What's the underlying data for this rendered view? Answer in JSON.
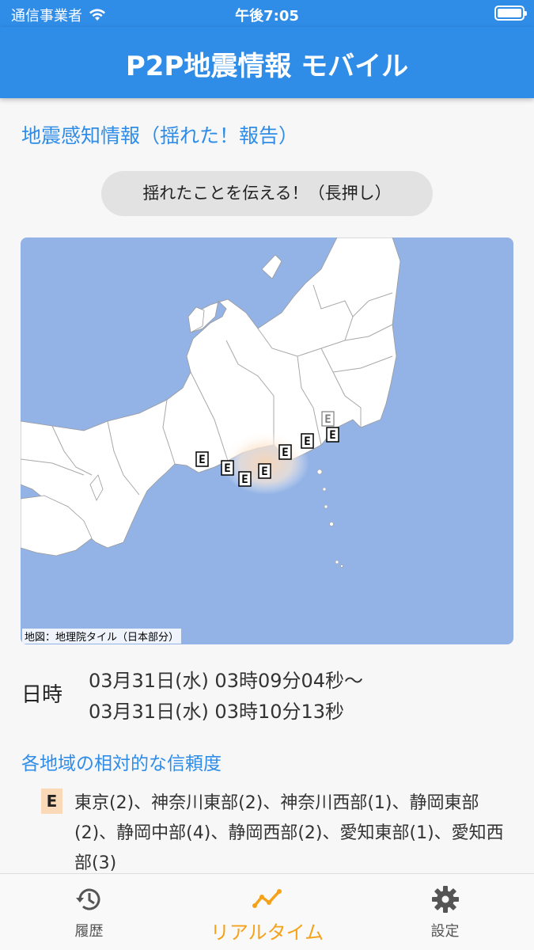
{
  "status_bar": {
    "carrier": "通信事業者",
    "time": "午後7:05"
  },
  "app": {
    "title": "P2P地震情報 モバイル"
  },
  "section_report": {
    "title": "地震感知情報（揺れた！報告）",
    "button_label": "揺れたことを伝える！（長押し）"
  },
  "map": {
    "credit": "地図：地理院タイル（日本部分）",
    "marker_label": "E",
    "ocean_color": "#93b3e6",
    "land_color": "#ffffff"
  },
  "datetime": {
    "label": "日時",
    "start": "03月31日(水) 03時09分04秒～",
    "end": "03月31日(水) 03時10分13秒"
  },
  "section_reliability": {
    "title": "各地域の相対的な信頼度",
    "icon_label": "E",
    "regions_text": "東京(2)、神奈川東部(2)、神奈川西部(1)、静岡東部(2)、静岡中部(4)、静岡西部(2)、愛知東部(1)、愛知西部(3)"
  },
  "tabs": [
    {
      "id": "history",
      "label": "履歴",
      "icon": "history-icon"
    },
    {
      "id": "realtime",
      "label": "リアルタイム",
      "icon": "chart-line-icon",
      "active": true
    },
    {
      "id": "settings",
      "label": "設定",
      "icon": "gear-icon"
    }
  ],
  "colors": {
    "brand": "#2f8de8",
    "active_tab": "#f5a21b",
    "marker_bg": "#f9d9b8"
  }
}
